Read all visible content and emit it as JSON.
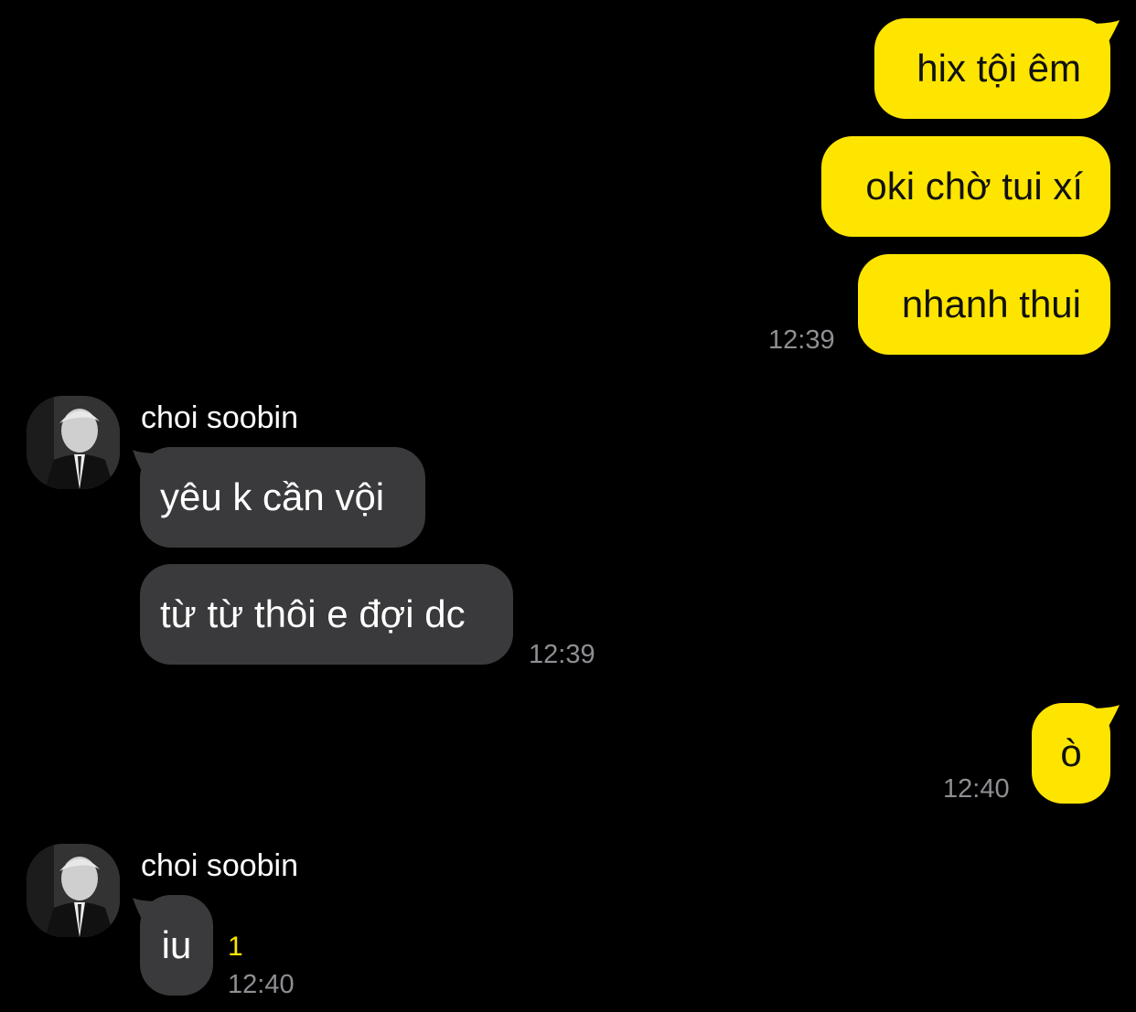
{
  "chat": {
    "colors": {
      "outgoing": "#FEE500",
      "incoming": "#3a3a3c",
      "background": "#000000",
      "timestamp": "#8e8e93"
    },
    "messages": [
      {
        "text": "hix tội êm"
      },
      {
        "text": "oki chờ tui xí"
      },
      {
        "text": "nhanh thui",
        "time": "12:39"
      },
      {
        "sender": "choi soobin",
        "text": "yêu k cần vội"
      },
      {
        "text": "từ từ thôi e đợi dc",
        "time": "12:39"
      },
      {
        "text": "ò",
        "time": "12:40"
      },
      {
        "sender": "choi soobin",
        "text": "iu",
        "unread": "1",
        "time": "12:40"
      }
    ]
  }
}
